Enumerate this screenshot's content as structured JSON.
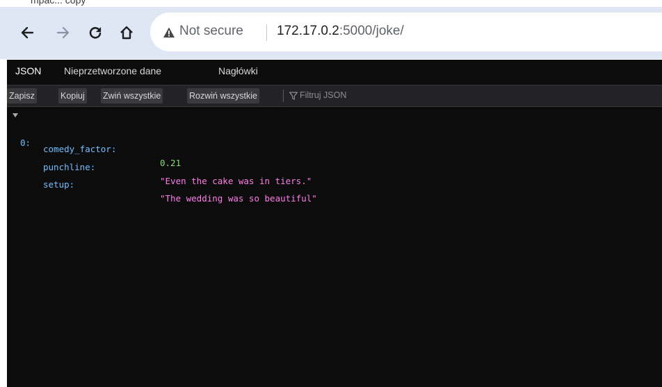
{
  "page": {
    "top_cut_text": "mpac... copy"
  },
  "browser": {
    "security_label": "Not secure",
    "url_host": "172.17.0.2",
    "url_rest": ":5000/joke/"
  },
  "viewer_tabs": [
    {
      "label": "JSON"
    },
    {
      "label": "Nieprzetworzone dane"
    },
    {
      "label": "Nagłówki"
    }
  ],
  "toolbar": {
    "save": "Zapisz",
    "copy": "Kopiuj",
    "collapse_all": "Zwiń wszystkie",
    "expand_all": "Rozwiń wszystkie",
    "filter_placeholder": "Filtruj JSON"
  },
  "json_tree": {
    "root_label": "0:",
    "rows": [
      {
        "key": "comedy_factor:",
        "value": "0.21",
        "type": "number"
      },
      {
        "key": "punchline:",
        "value": "\"Even the cake was in tiers.\"",
        "type": "string"
      },
      {
        "key": "setup:",
        "value": "\"The wedding was so beautiful\"",
        "type": "string"
      }
    ]
  },
  "colors": {
    "toolbar_bg": "#dfe7f5",
    "viewer_bg": "#0c0c0d",
    "key": "#75bfff",
    "number": "#86de74",
    "string": "#ff7de9"
  },
  "icons": [
    "back-arrow-icon",
    "forward-arrow-icon",
    "reload-icon",
    "home-icon",
    "warning-icon",
    "filter-icon",
    "expand-twisty-icon"
  ]
}
